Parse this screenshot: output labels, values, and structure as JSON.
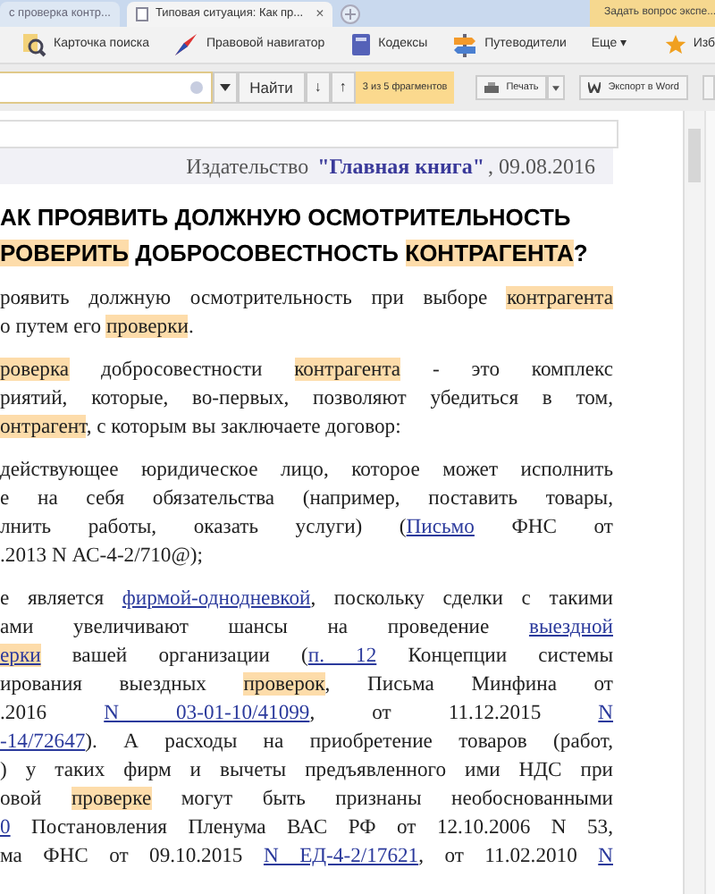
{
  "browser_tabs": [
    {
      "label": "с проверка контр...",
      "selected": false
    },
    {
      "label": "Типовая ситуация: Как пр...",
      "selected": true,
      "close": "×"
    }
  ],
  "ask_expert": "Задать вопрос экспе...",
  "toolbar": [
    {
      "label": "Карточка поиска",
      "kind": "search"
    },
    {
      "label": "Правовой навигатор",
      "kind": "navigator"
    },
    {
      "label": "Кодексы",
      "kind": "codes"
    },
    {
      "label": "Путеводители",
      "kind": "guides"
    },
    {
      "label": "Еще ▾",
      "kind": "more"
    }
  ],
  "favorites": "Изб",
  "search": {
    "find": "Найти",
    "down": "↓",
    "up": "↑",
    "found": "3 из 5 фрагментов",
    "print": "Печать",
    "export": "Экспорт в Word"
  },
  "publisher": [
    {
      "text": "Издательство ",
      "kind": "plain"
    },
    {
      "text": "\"Главная книга\"",
      "kind": "link"
    },
    {
      "text": ", 09.08.2016",
      "kind": "plain"
    }
  ],
  "heading": [
    [
      {
        "text": "АК ПРОЯВИТЬ ДОЛЖНУЮ ОСМОТРИТЕЛЬНОСТЬ",
        "kind": "plain"
      }
    ],
    [
      {
        "text": "РОВЕРИТЬ",
        "kind": "hl"
      },
      {
        "text": " ДОБРОСОВЕСТНОСТЬ ",
        "kind": "plain"
      },
      {
        "text": "КОНТРАГЕНТА",
        "kind": "hl"
      },
      {
        "text": "?",
        "kind": "plain"
      }
    ]
  ],
  "paragraphs": [
    [
      {
        "justified": true,
        "segments": [
          {
            "text": "роявить должную осмотрительность при выборе ",
            "kind": "plain"
          },
          {
            "text": "контрагента",
            "kind": "hl"
          }
        ]
      },
      {
        "justified": false,
        "segments": [
          {
            "text": "о путем его ",
            "kind": "plain"
          },
          {
            "text": "проверки",
            "kind": "hl"
          },
          {
            "text": ".",
            "kind": "plain"
          }
        ]
      }
    ],
    [
      {
        "justified": true,
        "segments": [
          {
            "text": "роверка",
            "kind": "hl"
          },
          {
            "text": " добросовестности ",
            "kind": "plain"
          },
          {
            "text": "контрагента",
            "kind": "hl"
          },
          {
            "text": " - это комплекс",
            "kind": "plain"
          }
        ]
      },
      {
        "justified": true,
        "segments": [
          {
            "text": "риятий, которые, во-первых, позволяют убедиться в том,",
            "kind": "plain"
          }
        ]
      },
      {
        "justified": false,
        "segments": [
          {
            "text": "онтрагент",
            "kind": "hl"
          },
          {
            "text": ", с которым вы заключаете договор:",
            "kind": "plain"
          }
        ]
      }
    ],
    [
      {
        "justified": true,
        "segments": [
          {
            "text": "действующее юридическое лицо, которое может исполнить",
            "kind": "plain"
          }
        ]
      },
      {
        "justified": true,
        "segments": [
          {
            "text": "е на себя обязательства (например, поставить товары,",
            "kind": "plain"
          }
        ]
      },
      {
        "justified": true,
        "segments": [
          {
            "text": "лнить работы, оказать услуги) (",
            "kind": "plain"
          },
          {
            "text": "Письмо",
            "kind": "link"
          },
          {
            "text": " ФНС от",
            "kind": "plain"
          }
        ]
      },
      {
        "justified": false,
        "segments": [
          {
            "text": ".2013 N АС-4-2/710@);",
            "kind": "plain"
          }
        ]
      }
    ],
    [
      {
        "justified": true,
        "segments": [
          {
            "text": "е является ",
            "kind": "plain"
          },
          {
            "text": "фирмой-однодневкой",
            "kind": "link"
          },
          {
            "text": ", поскольку сделки с такими",
            "kind": "plain"
          }
        ]
      },
      {
        "justified": true,
        "segments": [
          {
            "text": "ами увеличивают шансы на проведение ",
            "kind": "plain"
          },
          {
            "text": "выездной",
            "kind": "link"
          }
        ]
      },
      {
        "justified": true,
        "segments": [
          {
            "text": "ерки",
            "kind": "link_hl"
          },
          {
            "text": " вашей организации (",
            "kind": "plain"
          },
          {
            "text": "п. 12",
            "kind": "link"
          },
          {
            "text": " Концепции системы",
            "kind": "plain"
          }
        ]
      },
      {
        "justified": true,
        "segments": [
          {
            "text": "ирования выездных ",
            "kind": "plain"
          },
          {
            "text": "проверок",
            "kind": "hl"
          },
          {
            "text": ", Письма Минфина от",
            "kind": "plain"
          }
        ]
      },
      {
        "justified": true,
        "segments": [
          {
            "text": ".2016 ",
            "kind": "plain"
          },
          {
            "text": "N 03-01-10/41099",
            "kind": "link"
          },
          {
            "text": ", от 11.12.2015 ",
            "kind": "plain"
          },
          {
            "text": "N",
            "kind": "link"
          }
        ]
      },
      {
        "justified": true,
        "segments": [
          {
            "text": "-14/72647",
            "kind": "link"
          },
          {
            "text": "). А расходы на приобретение товаров (работ,",
            "kind": "plain"
          }
        ]
      },
      {
        "justified": true,
        "segments": [
          {
            "text": ") у таких фирм и вычеты предъявленного ими НДС при",
            "kind": "plain"
          }
        ]
      },
      {
        "justified": true,
        "segments": [
          {
            "text": "овой ",
            "kind": "plain"
          },
          {
            "text": "проверке",
            "kind": "hl"
          },
          {
            "text": " могут быть признаны необоснованными",
            "kind": "plain"
          }
        ]
      },
      {
        "justified": true,
        "segments": [
          {
            "text": "0",
            "kind": "link"
          },
          {
            "text": " Постановления Пленума ВАС РФ от 12.10.2006 N 53,",
            "kind": "plain"
          }
        ]
      },
      {
        "justified": true,
        "segments": [
          {
            "text": "ма ФНС от 09.10.2015 ",
            "kind": "plain"
          },
          {
            "text": "N ЕД-4-2/17621",
            "kind": "link"
          },
          {
            "text": ", от 11.02.2010 ",
            "kind": "plain"
          },
          {
            "text": "N",
            "kind": "link"
          }
        ]
      }
    ]
  ]
}
